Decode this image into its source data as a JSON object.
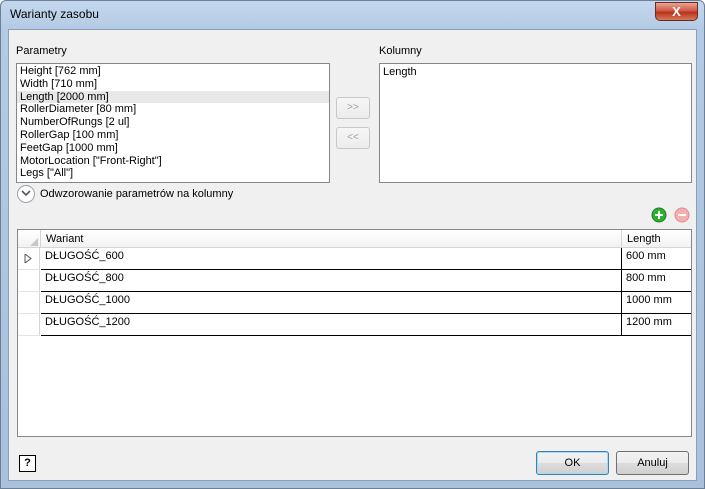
{
  "window": {
    "title": "Warianty zasobu",
    "close_label": "X"
  },
  "parameters": {
    "label": "Parametry",
    "items": [
      "Height [762 mm]",
      "Width [710 mm]",
      "Length [2000 mm]",
      "RollerDiameter [80 mm]",
      "NumberOfRungs [2 ul]",
      "RollerGap [100 mm]",
      "FeetGap [1000 mm]",
      "MotorLocation [\"Front-Right\"]",
      "Legs [\"All\"]"
    ],
    "selected_index": 2
  },
  "move_buttons": {
    "add": ">>",
    "remove": "<<"
  },
  "columns": {
    "label": "Kolumny",
    "items": [
      "Length"
    ]
  },
  "mapping": {
    "label": "Odwzorowanie parametrów na kolumny"
  },
  "grid": {
    "headers": [
      "Wariant",
      "Length"
    ],
    "rows": [
      {
        "variant": "DŁUGOŚĆ_600",
        "length": "600 mm"
      },
      {
        "variant": "DŁUGOŚĆ_800",
        "length": "800 mm"
      },
      {
        "variant": "DŁUGOŚĆ_1000",
        "length": "1000 mm"
      },
      {
        "variant": "DŁUGOŚĆ_1200",
        "length": "1200 mm"
      }
    ]
  },
  "footer": {
    "help_label": "?",
    "ok_label": "OK",
    "cancel_label": "Anuluj"
  },
  "colors": {
    "add_icon": "#2db02d",
    "remove_icon": "#f0a0a0"
  }
}
